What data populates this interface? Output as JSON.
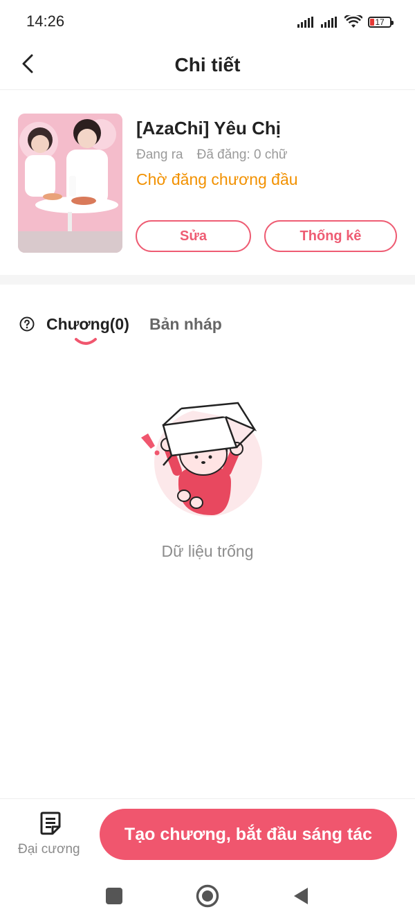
{
  "status_bar": {
    "time": "14:26",
    "battery_level": "17",
    "icons": [
      "signal-icon",
      "signal-icon",
      "wifi-icon",
      "battery-icon"
    ]
  },
  "header": {
    "title": "Chi tiết",
    "back_icon": "chevron-left-icon"
  },
  "book": {
    "title": "[AzaChi] Yêu Chị",
    "status": "Đang ra",
    "word_count": "Đã đăng: 0 chữ",
    "notice": "Chờ đăng chương đầu",
    "edit_label": "Sửa",
    "stats_label": "Thống kê"
  },
  "tabs": {
    "chapters_label": "Chương(0)",
    "drafts_label": "Bản nháp",
    "active": "chapters"
  },
  "empty_state": {
    "text": "Dữ liệu trống"
  },
  "bottom_bar": {
    "outline_label": "Đại cương",
    "create_label": "Tạo chương, bắt đầu sáng tác"
  },
  "colors": {
    "accent": "#f0566e",
    "accent_outline": "#ee5c73",
    "notice": "#f29100"
  }
}
